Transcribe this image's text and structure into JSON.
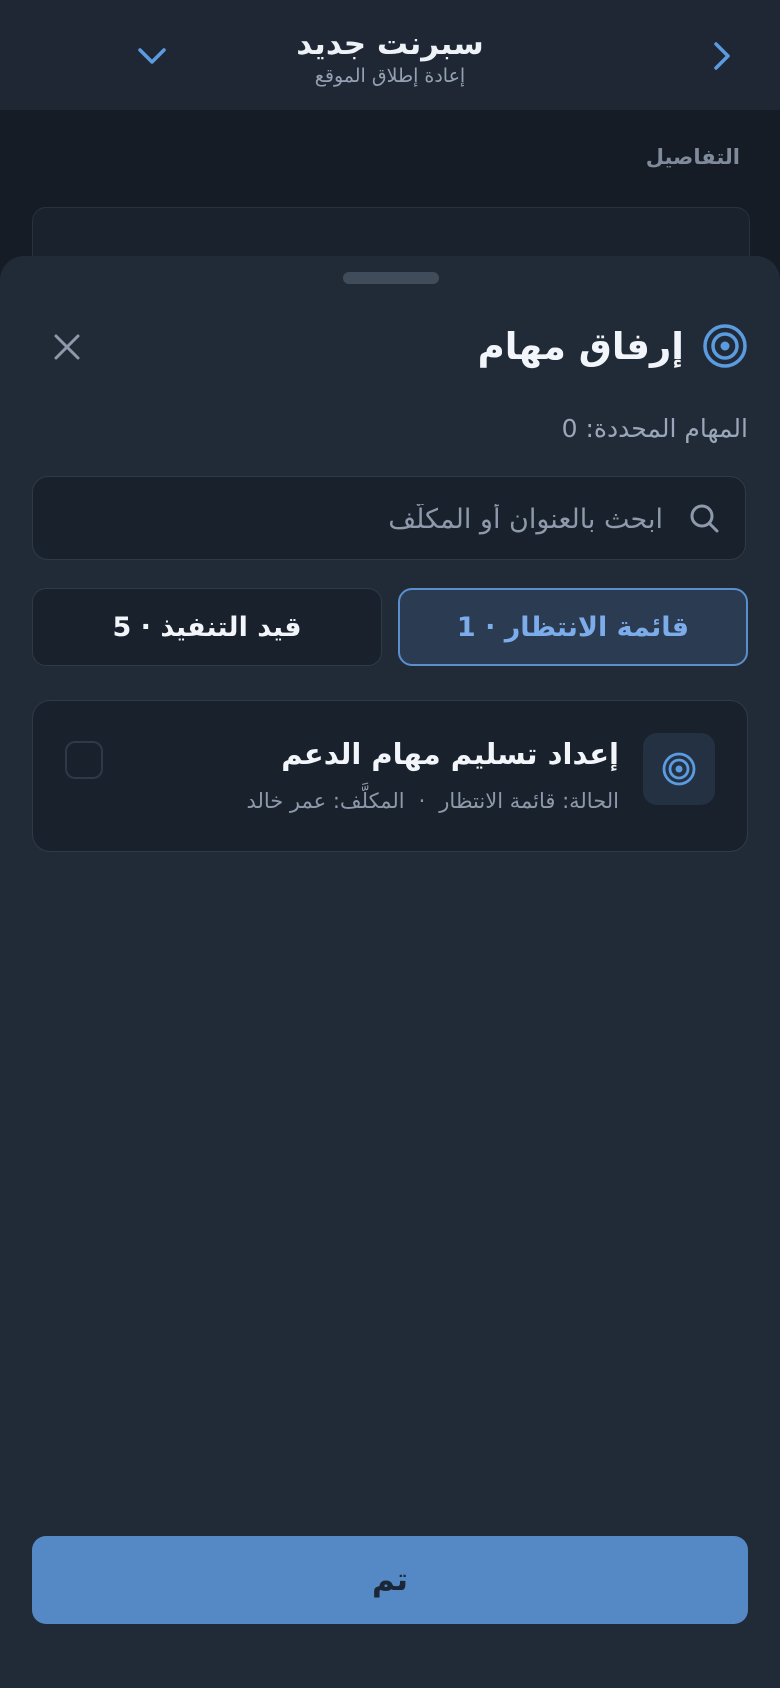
{
  "header": {
    "title": "سبرنت جديد",
    "subtitle": "إعادة إطلاق الموقع"
  },
  "background": {
    "section_label": "التفاصيل"
  },
  "sheet": {
    "title": "إرفاق مهام",
    "selected_count": "المهام المحددة: 0",
    "search": {
      "placeholder": "ابحث بالعنوان أو المكلَّف",
      "value": ""
    },
    "tabs": [
      {
        "label": "قائمة الانتظار · 1",
        "active": true
      },
      {
        "label": "قيد التنفيذ · 5",
        "active": false
      }
    ],
    "tasks": [
      {
        "title": "إعداد تسليم مهام الدعم",
        "status": "الحالة: قائمة الانتظار",
        "separator": "·",
        "assignee": "المكلَّف: عمر خالد",
        "checked": false
      }
    ],
    "done_label": "تم"
  },
  "colors": {
    "accent": "#5b8ecd",
    "primary_button": "#5589c5",
    "sheet_bg": "#212b38"
  },
  "icons": [
    "chevron-right-icon",
    "chevron-down-icon",
    "target-icon",
    "close-icon",
    "search-icon"
  ]
}
